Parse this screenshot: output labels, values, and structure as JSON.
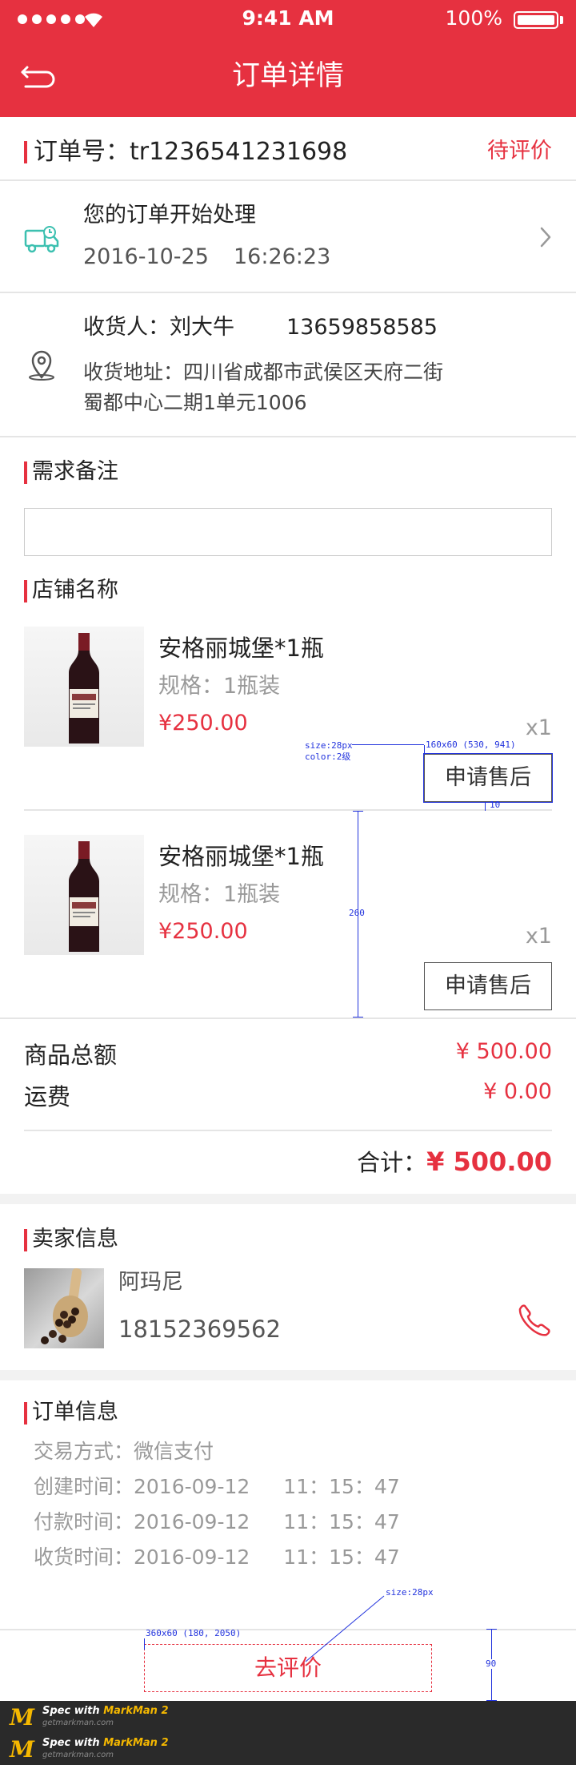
{
  "status_bar": {
    "time": "9:41 AM",
    "battery": "100%"
  },
  "header": {
    "title": "订单详情"
  },
  "order": {
    "number_label": "订单号：",
    "number": "tr1236541231698",
    "status": "待评价"
  },
  "logistics": {
    "message": "您的订单开始处理",
    "date": "2016-10-25",
    "time": "16:26:23"
  },
  "receiver": {
    "label": "收货人：",
    "name": "刘大牛",
    "phone": "13659858585",
    "address_line1": "收货地址：四川省成都市武侯区天府二街",
    "address_line2": "蜀都中心二期1单元1006"
  },
  "remark": {
    "title": "需求备注",
    "value": ""
  },
  "shop": {
    "title": "店铺名称",
    "items": [
      {
        "name": "安格丽城堡*1瓶",
        "spec": "规格：1瓶装",
        "price": "¥250.00",
        "qty": "x1",
        "button": "申请售后"
      },
      {
        "name": "安格丽城堡*1瓶",
        "spec": "规格：1瓶装",
        "price": "¥250.00",
        "qty": "x1",
        "button": "申请售后"
      }
    ]
  },
  "summary": {
    "goods_label": "商品总额",
    "goods_value": "¥ 500.00",
    "freight_label": "运费",
    "freight_value": "¥ 0.00",
    "total_label": "合计：",
    "total_value": "¥ 500.00"
  },
  "seller": {
    "title": "卖家信息",
    "name": "阿玛尼",
    "phone": "18152369562"
  },
  "order_info": {
    "title": "订单信息",
    "payment": "交易方式：微信支付",
    "created": "创建时间：2016-09-12",
    "created_time": "11：15：47",
    "paid": "付款时间：2016-09-12",
    "paid_time": "11：15：47",
    "received": "收货时间：2016-09-12",
    "received_time": "11：15：47"
  },
  "bottom": {
    "review_button": "去评价"
  },
  "annotations": {
    "size_note": "size:28px",
    "color_note": "color:2级",
    "after_sale_spec": "160x60 (530, 941)",
    "gap_10": "10",
    "height_260": "260",
    "review_size_note": "size:28px",
    "review_spec": "360x60 (180, 2050)",
    "height_90": "90"
  },
  "footer": {
    "brand_line1_a": "Spec with ",
    "brand_line1_b": "MarkMan 2",
    "brand_line2": "getmarkman.com"
  },
  "colors": {
    "brand": "#e63140",
    "teal_icon": "#3cc0b0"
  }
}
